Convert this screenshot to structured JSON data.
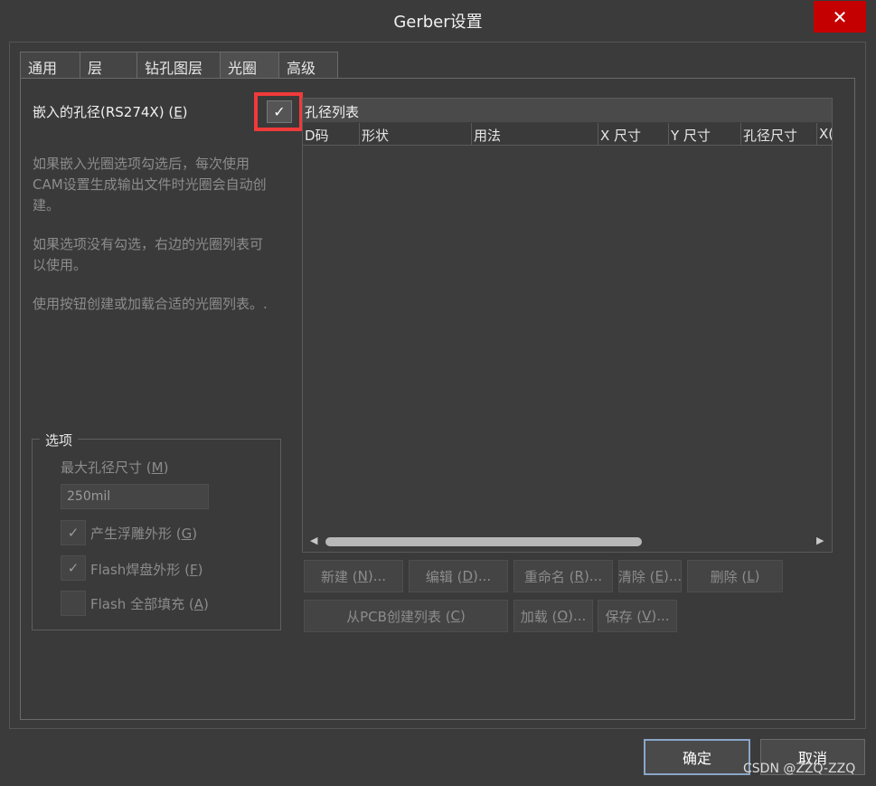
{
  "window": {
    "title": "Gerber设置",
    "close_glyph": "✕"
  },
  "tabs": [
    {
      "label": "通用",
      "active": false
    },
    {
      "label": "层",
      "active": false
    },
    {
      "label": "钻孔图层",
      "active": false
    },
    {
      "label": "光圈",
      "active": true
    },
    {
      "label": "高级",
      "active": false
    }
  ],
  "embedded": {
    "label_prefix": "嵌入的孔径(RS274X) (",
    "label_key": "E",
    "label_suffix": ")",
    "checked": true,
    "check_glyph": "✓"
  },
  "help_text": {
    "p1": "如果嵌入光圈选项勾选后，每次使用CAM设置生成输出文件时光圈会自动创建。",
    "p2": "如果选项没有勾选，右边的光圈列表可以使用。",
    "p3": "使用按钮创建或加载合适的光圈列表。."
  },
  "options": {
    "group_title": "选项",
    "max_aperture_label_prefix": "最大孔径尺寸 (",
    "max_aperture_label_key": "M",
    "max_aperture_label_suffix": ")",
    "max_aperture_value": "250mil",
    "items": [
      {
        "label_prefix": "产生浮雕外形 (",
        "key": "G",
        "label_suffix": ")",
        "checked": true,
        "glyph": "✓"
      },
      {
        "label_prefix": "Flash焊盘外形 (",
        "key": "F",
        "label_suffix": ")",
        "checked": true,
        "glyph": "✓"
      },
      {
        "label_prefix": "Flash 全部填充 (",
        "key": "A",
        "label_suffix": ")",
        "checked": false,
        "glyph": ""
      }
    ]
  },
  "aperture_list": {
    "title": "孔径列表",
    "columns": [
      "D码",
      "形状",
      "用法",
      "X 尺寸",
      "Y 尺寸",
      "孔径尺寸",
      "X("
    ],
    "rows": [],
    "scroll_left_glyph": "◀",
    "scroll_right_glyph": "▶"
  },
  "actions": {
    "new": {
      "prefix": "新建 (",
      "key": "N",
      "suffix": ")..."
    },
    "edit": {
      "prefix": "编辑 (",
      "key": "D",
      "suffix": ")..."
    },
    "rename": {
      "prefix": "重命名 (",
      "key": "R",
      "suffix": ")..."
    },
    "clear": {
      "prefix": "清除 (",
      "key": "E",
      "suffix": ")..."
    },
    "delete": {
      "prefix": "删除 (",
      "key": "L",
      "suffix": ")"
    },
    "from_pcb": {
      "prefix": "从PCB创建列表 (",
      "key": "C",
      "suffix": ")"
    },
    "load": {
      "prefix": "加载 (",
      "key": "O",
      "suffix": ")..."
    },
    "save": {
      "prefix": "保存 (",
      "key": "V",
      "suffix": ")..."
    }
  },
  "footer": {
    "ok_label": "确定",
    "cancel_label": "取消",
    "watermark": "CSDN @ZZQ-ZZQ"
  }
}
